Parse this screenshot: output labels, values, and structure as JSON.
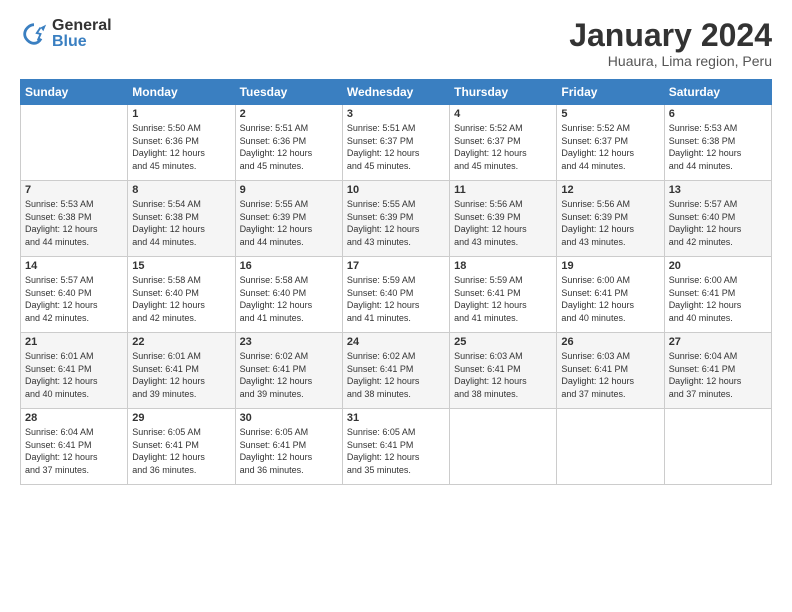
{
  "logo": {
    "general": "General",
    "blue": "Blue"
  },
  "header": {
    "month": "January 2024",
    "location": "Huaura, Lima region, Peru"
  },
  "weekdays": [
    "Sunday",
    "Monday",
    "Tuesday",
    "Wednesday",
    "Thursday",
    "Friday",
    "Saturday"
  ],
  "weeks": [
    [
      {
        "day": "",
        "sunrise": "",
        "sunset": "",
        "daylight": ""
      },
      {
        "day": "1",
        "sunrise": "Sunrise: 5:50 AM",
        "sunset": "Sunset: 6:36 PM",
        "daylight": "Daylight: 12 hours and 45 minutes."
      },
      {
        "day": "2",
        "sunrise": "Sunrise: 5:51 AM",
        "sunset": "Sunset: 6:36 PM",
        "daylight": "Daylight: 12 hours and 45 minutes."
      },
      {
        "day": "3",
        "sunrise": "Sunrise: 5:51 AM",
        "sunset": "Sunset: 6:37 PM",
        "daylight": "Daylight: 12 hours and 45 minutes."
      },
      {
        "day": "4",
        "sunrise": "Sunrise: 5:52 AM",
        "sunset": "Sunset: 6:37 PM",
        "daylight": "Daylight: 12 hours and 45 minutes."
      },
      {
        "day": "5",
        "sunrise": "Sunrise: 5:52 AM",
        "sunset": "Sunset: 6:37 PM",
        "daylight": "Daylight: 12 hours and 44 minutes."
      },
      {
        "day": "6",
        "sunrise": "Sunrise: 5:53 AM",
        "sunset": "Sunset: 6:38 PM",
        "daylight": "Daylight: 12 hours and 44 minutes."
      }
    ],
    [
      {
        "day": "7",
        "sunrise": "Sunrise: 5:53 AM",
        "sunset": "Sunset: 6:38 PM",
        "daylight": "Daylight: 12 hours and 44 minutes."
      },
      {
        "day": "8",
        "sunrise": "Sunrise: 5:54 AM",
        "sunset": "Sunset: 6:38 PM",
        "daylight": "Daylight: 12 hours and 44 minutes."
      },
      {
        "day": "9",
        "sunrise": "Sunrise: 5:55 AM",
        "sunset": "Sunset: 6:39 PM",
        "daylight": "Daylight: 12 hours and 44 minutes."
      },
      {
        "day": "10",
        "sunrise": "Sunrise: 5:55 AM",
        "sunset": "Sunset: 6:39 PM",
        "daylight": "Daylight: 12 hours and 43 minutes."
      },
      {
        "day": "11",
        "sunrise": "Sunrise: 5:56 AM",
        "sunset": "Sunset: 6:39 PM",
        "daylight": "Daylight: 12 hours and 43 minutes."
      },
      {
        "day": "12",
        "sunrise": "Sunrise: 5:56 AM",
        "sunset": "Sunset: 6:39 PM",
        "daylight": "Daylight: 12 hours and 43 minutes."
      },
      {
        "day": "13",
        "sunrise": "Sunrise: 5:57 AM",
        "sunset": "Sunset: 6:40 PM",
        "daylight": "Daylight: 12 hours and 42 minutes."
      }
    ],
    [
      {
        "day": "14",
        "sunrise": "Sunrise: 5:57 AM",
        "sunset": "Sunset: 6:40 PM",
        "daylight": "Daylight: 12 hours and 42 minutes."
      },
      {
        "day": "15",
        "sunrise": "Sunrise: 5:58 AM",
        "sunset": "Sunset: 6:40 PM",
        "daylight": "Daylight: 12 hours and 42 minutes."
      },
      {
        "day": "16",
        "sunrise": "Sunrise: 5:58 AM",
        "sunset": "Sunset: 6:40 PM",
        "daylight": "Daylight: 12 hours and 41 minutes."
      },
      {
        "day": "17",
        "sunrise": "Sunrise: 5:59 AM",
        "sunset": "Sunset: 6:40 PM",
        "daylight": "Daylight: 12 hours and 41 minutes."
      },
      {
        "day": "18",
        "sunrise": "Sunrise: 5:59 AM",
        "sunset": "Sunset: 6:41 PM",
        "daylight": "Daylight: 12 hours and 41 minutes."
      },
      {
        "day": "19",
        "sunrise": "Sunrise: 6:00 AM",
        "sunset": "Sunset: 6:41 PM",
        "daylight": "Daylight: 12 hours and 40 minutes."
      },
      {
        "day": "20",
        "sunrise": "Sunrise: 6:00 AM",
        "sunset": "Sunset: 6:41 PM",
        "daylight": "Daylight: 12 hours and 40 minutes."
      }
    ],
    [
      {
        "day": "21",
        "sunrise": "Sunrise: 6:01 AM",
        "sunset": "Sunset: 6:41 PM",
        "daylight": "Daylight: 12 hours and 40 minutes."
      },
      {
        "day": "22",
        "sunrise": "Sunrise: 6:01 AM",
        "sunset": "Sunset: 6:41 PM",
        "daylight": "Daylight: 12 hours and 39 minutes."
      },
      {
        "day": "23",
        "sunrise": "Sunrise: 6:02 AM",
        "sunset": "Sunset: 6:41 PM",
        "daylight": "Daylight: 12 hours and 39 minutes."
      },
      {
        "day": "24",
        "sunrise": "Sunrise: 6:02 AM",
        "sunset": "Sunset: 6:41 PM",
        "daylight": "Daylight: 12 hours and 38 minutes."
      },
      {
        "day": "25",
        "sunrise": "Sunrise: 6:03 AM",
        "sunset": "Sunset: 6:41 PM",
        "daylight": "Daylight: 12 hours and 38 minutes."
      },
      {
        "day": "26",
        "sunrise": "Sunrise: 6:03 AM",
        "sunset": "Sunset: 6:41 PM",
        "daylight": "Daylight: 12 hours and 37 minutes."
      },
      {
        "day": "27",
        "sunrise": "Sunrise: 6:04 AM",
        "sunset": "Sunset: 6:41 PM",
        "daylight": "Daylight: 12 hours and 37 minutes."
      }
    ],
    [
      {
        "day": "28",
        "sunrise": "Sunrise: 6:04 AM",
        "sunset": "Sunset: 6:41 PM",
        "daylight": "Daylight: 12 hours and 37 minutes."
      },
      {
        "day": "29",
        "sunrise": "Sunrise: 6:05 AM",
        "sunset": "Sunset: 6:41 PM",
        "daylight": "Daylight: 12 hours and 36 minutes."
      },
      {
        "day": "30",
        "sunrise": "Sunrise: 6:05 AM",
        "sunset": "Sunset: 6:41 PM",
        "daylight": "Daylight: 12 hours and 36 minutes."
      },
      {
        "day": "31",
        "sunrise": "Sunrise: 6:05 AM",
        "sunset": "Sunset: 6:41 PM",
        "daylight": "Daylight: 12 hours and 35 minutes."
      },
      {
        "day": "",
        "sunrise": "",
        "sunset": "",
        "daylight": ""
      },
      {
        "day": "",
        "sunrise": "",
        "sunset": "",
        "daylight": ""
      },
      {
        "day": "",
        "sunrise": "",
        "sunset": "",
        "daylight": ""
      }
    ]
  ]
}
